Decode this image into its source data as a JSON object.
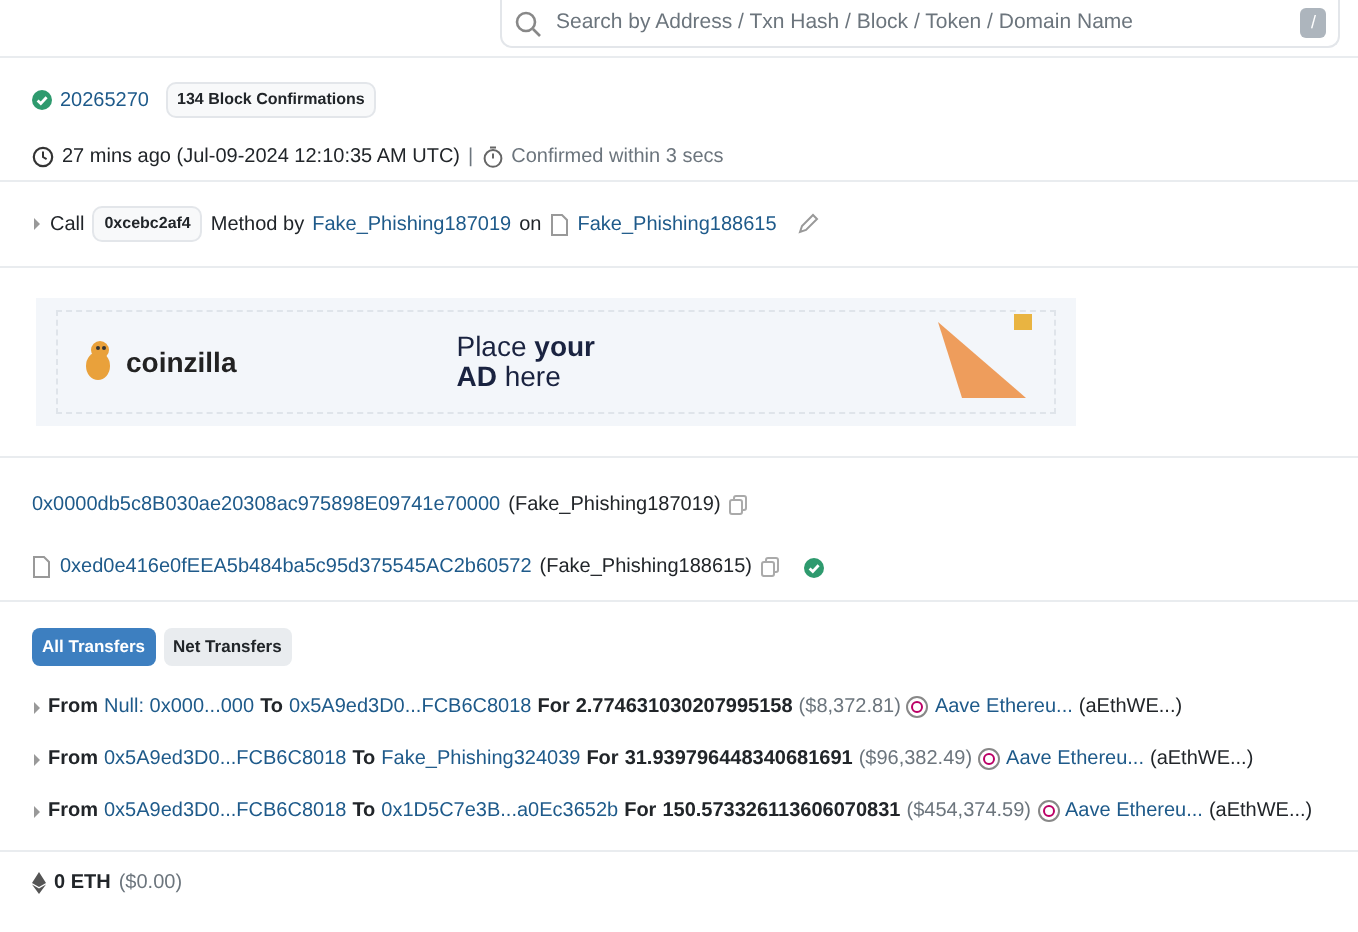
{
  "search": {
    "placeholder": "Search by Address / Txn Hash / Block / Token / Domain Name",
    "shortcut": "/"
  },
  "block": {
    "number": "20265270",
    "confirmations": "134 Block Confirmations"
  },
  "timestamp": {
    "age": "27 mins ago (Jul-09-2024 12:10:35 AM UTC)",
    "separator": "|",
    "confirmed": "Confirmed within 3 secs"
  },
  "call": {
    "label": "Call",
    "method_id": "0xcebc2af4",
    "method_by": "Method by",
    "caller": "Fake_Phishing187019",
    "on": "on",
    "contract": "Fake_Phishing188615"
  },
  "ad": {
    "brand": "coinzilla",
    "line_1": "Place **your**",
    "line_2": "**AD** here"
  },
  "from": {
    "address": "0x0000db5c8B030ae20308ac975898E09741e70000",
    "name": "(Fake_Phishing187019)"
  },
  "to": {
    "address": "0xed0e416e0fEEA5b484ba5c95d375545AC2b60572",
    "name": "(Fake_Phishing188615)",
    "verified": true
  },
  "transfer_tabs": [
    {
      "label": "All Transfers",
      "selected": true
    },
    {
      "label": "Net Transfers",
      "selected": false
    }
  ],
  "transfers": [
    {
      "from_label": "From",
      "from": "Null: 0x000...000",
      "to_label": "To",
      "to": "0x5A9ed3D0...FCB6C8018",
      "for_label": "For",
      "amount": "2.774631030207995158",
      "usd": "($8,372.81)",
      "token": "Aave Ethereu...",
      "symbol": "(aEthWE...)"
    },
    {
      "from_label": "From",
      "from": "0x5A9ed3D0...FCB6C8018",
      "to_label": "To",
      "to": "Fake_Phishing324039",
      "for_label": "For",
      "amount": "31.939796448340681691",
      "usd": "($96,382.49)",
      "token": "Aave Ethereu...",
      "symbol": "(aEthWE...)"
    },
    {
      "from_label": "From",
      "from": "0x5A9ed3D0...FCB6C8018",
      "to_label": "To",
      "to": "0x1D5C7e3B...a0Ec3652b",
      "for_label": "For",
      "amount": "150.573326113606070831",
      "usd": "($454,374.59)",
      "token": "Aave Ethereu...",
      "symbol": "(aEthWE...)"
    }
  ],
  "value": {
    "amount": "0 ETH",
    "usd": "($0.00)"
  }
}
